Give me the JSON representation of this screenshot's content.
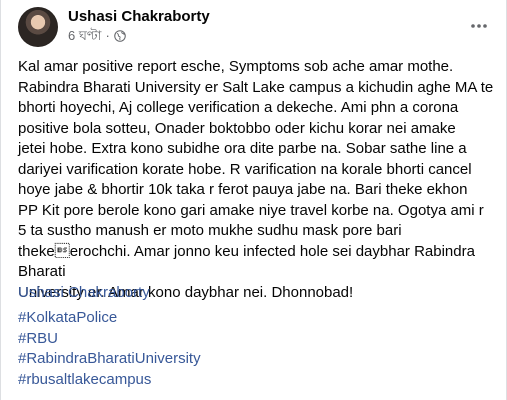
{
  "post": {
    "author": "Ushasi Chakraborty",
    "timestamp": "6 ঘণ্টা",
    "separator": "·",
    "privacy_icon": "globe-icon",
    "more_icon": "more-options-icon",
    "body": "Kal amar positive report esche, Symptoms sob ache amar mothe.\nRabindra Bharati University er Salt Lake campus a kichudin aghe MA te\nbhorti hoyechi, Aj college verification a dekeche. Ami phn a corona\npositive bola sotteu, Onader boktobbo oder kichu korar nei amake\njetei hobe. Extra kono subidhe ora dite parbe na. Sobar sathe line a\ndariyei varification korate hobe. R varification na korale bhorti cancel\nhoye jabe & bhortir 10k taka r ferot pauya jabe na. Bari theke ekhon\nPP Kit pore berole kono gari amake niye travel korbe na. Ogotya ami r\n5 ta sustho manush er moto mukhe sudhu mask pore bari theke\berochchi. Amar jonno keu infected hole sei daybhar Rabindra Bharati\nUniversity er. Amar kono daybhar nei. Dhonnobad!",
    "signature": "Ushasi Chakraborty",
    "hashtags": [
      "#KolkataPolice",
      "#RBU",
      "#RabindraBharatiUniversity",
      "#rbusaltlakecampus"
    ]
  },
  "colors": {
    "link": "#385898",
    "meta": "#65676b",
    "text": "#050505"
  }
}
